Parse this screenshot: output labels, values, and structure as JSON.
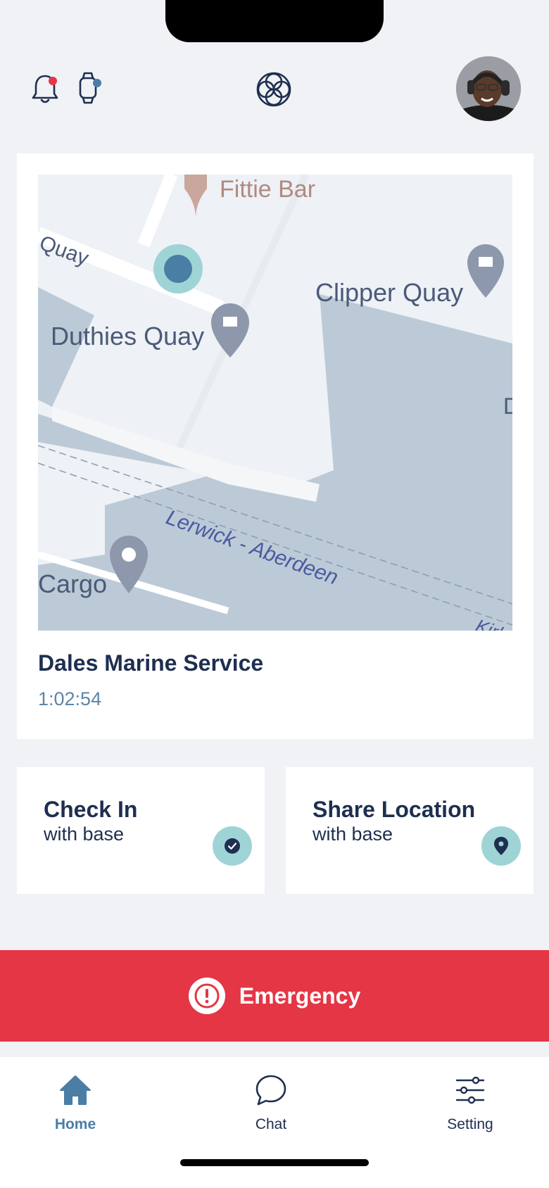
{
  "header": {
    "icons": [
      "bell-icon",
      "watch-icon",
      "app-logo-icon",
      "avatar"
    ],
    "bell_badge_color": "#e53645",
    "watch_badge_color": "#4a7ea4"
  },
  "map": {
    "labels": {
      "fittie_bar": "Fittie Bar",
      "quay": "Quay",
      "clipper_quay": "Clipper Quay",
      "duthies_quay": "Duthies Quay",
      "lerwick_aberdeen": "Lerwick - Aberdeen",
      "cargo": "Cargo",
      "kirk": "Kirk",
      "d": "D"
    }
  },
  "location_card": {
    "name": "Dales Marine Service",
    "time": "1:02:54"
  },
  "actions": {
    "check_in": {
      "title": "Check In",
      "subtitle": "with base",
      "icon": "check-icon"
    },
    "share_location": {
      "title": "Share Location",
      "subtitle": "with base",
      "icon": "location-pin-icon"
    }
  },
  "emergency": {
    "label": "Emergency",
    "icon": "alert-icon",
    "color": "#e53645"
  },
  "tabbar": {
    "home": "Home",
    "chat": "Chat",
    "setting": "Setting",
    "active": "home"
  },
  "colors": {
    "accent": "#4a7ea4",
    "navy": "#1e2f50",
    "teal": "#9fd4d6",
    "water": "#bccad7"
  }
}
